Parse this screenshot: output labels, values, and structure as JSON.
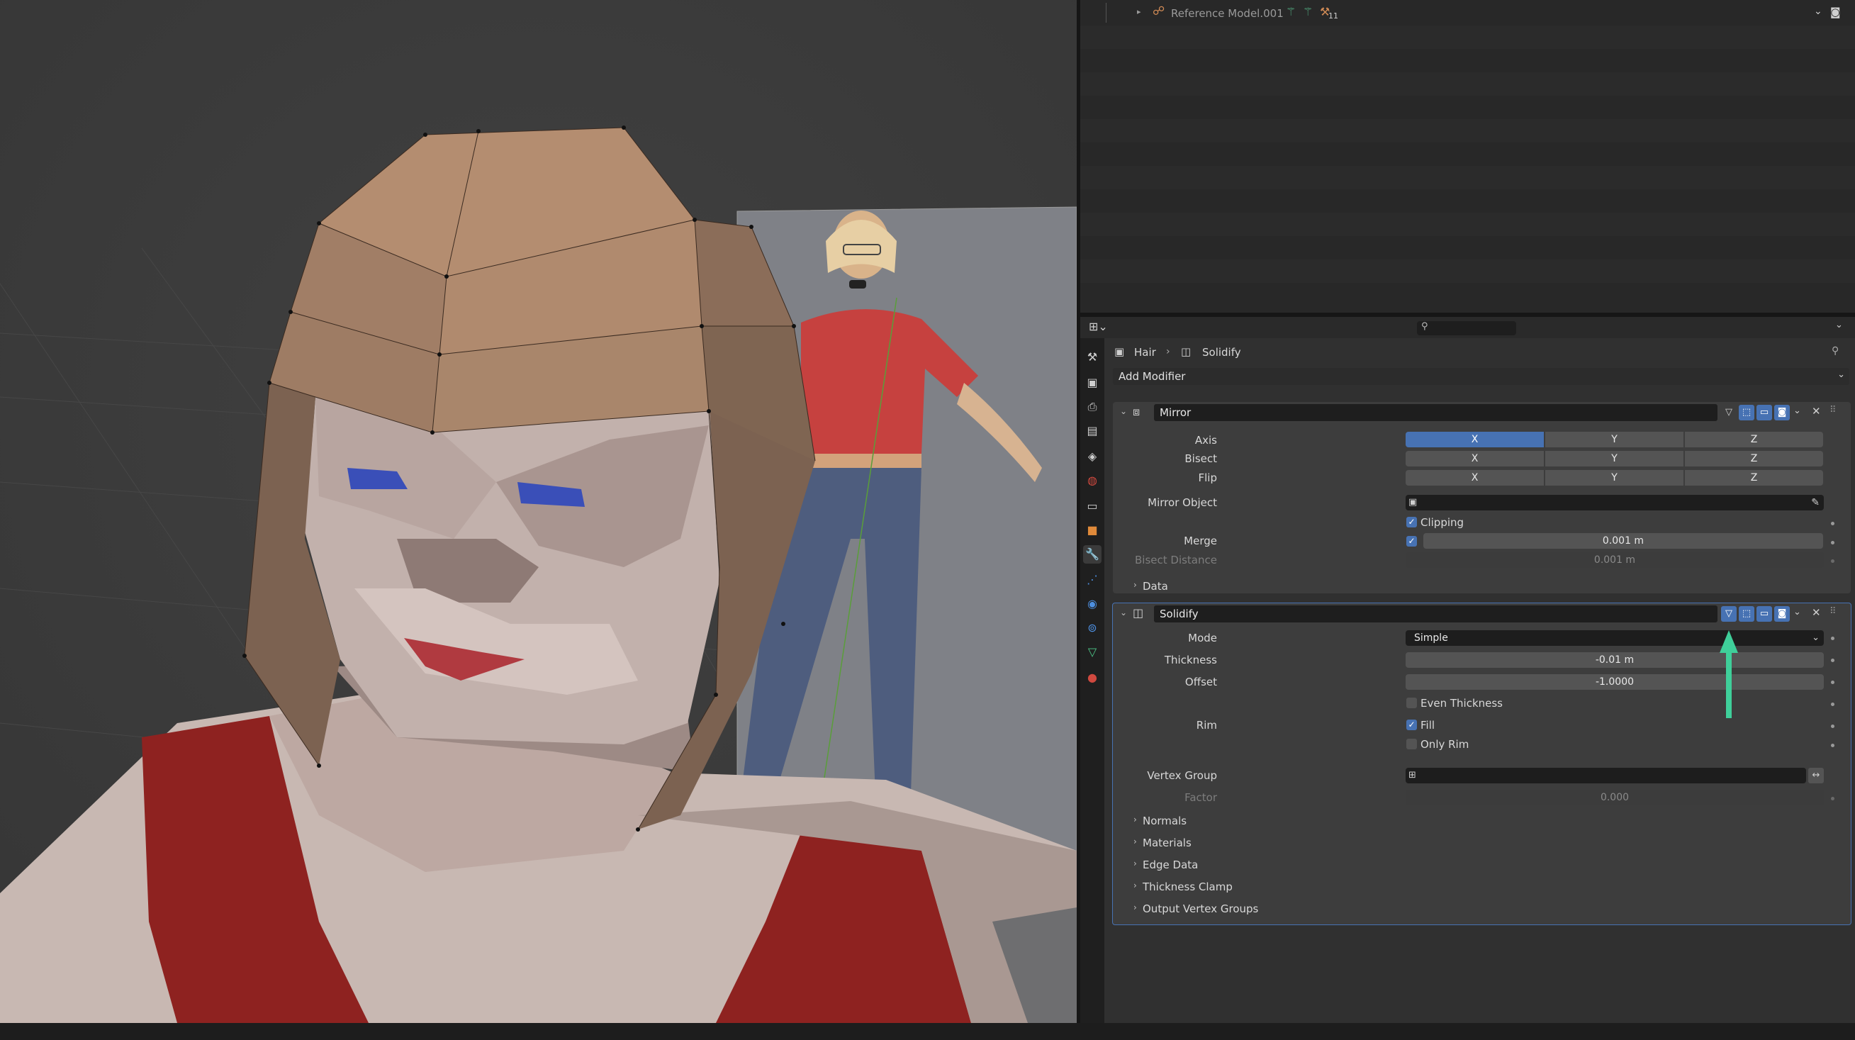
{
  "outliner": {
    "item_label": "Reference Model.001",
    "item_badge": "11"
  },
  "header": {
    "breadcrumb_object": "Hair",
    "breadcrumb_modifier": "Solidify"
  },
  "add_modifier_label": "Add Modifier",
  "mirror": {
    "name": "Mirror",
    "axis_label": "Axis",
    "bisect_label": "Bisect",
    "flip_label": "Flip",
    "x": "X",
    "y": "Y",
    "z": "Z",
    "mirror_object_label": "Mirror Object",
    "clipping_label": "Clipping",
    "merge_label": "Merge",
    "merge_value": "0.001 m",
    "bisect_distance_label": "Bisect Distance",
    "bisect_distance_value": "0.001 m",
    "data_label": "Data"
  },
  "solidify": {
    "name": "Solidify",
    "mode_label": "Mode",
    "mode_value": "Simple",
    "thickness_label": "Thickness",
    "thickness_value": "-0.01 m",
    "offset_label": "Offset",
    "offset_value": "-1.0000",
    "even_thickness_label": "Even Thickness",
    "rim_label": "Rim",
    "fill_label": "Fill",
    "only_rim_label": "Only Rim",
    "vertex_group_label": "Vertex Group",
    "factor_label": "Factor",
    "factor_value": "0.000",
    "subpanels": [
      "Normals",
      "Materials",
      "Edge Data",
      "Thickness Clamp",
      "Output Vertex Groups"
    ]
  },
  "colors": {
    "accent": "#4772b3",
    "annotation_arrow": "#3fcf9a",
    "hair": "#a8846a",
    "shirt": "#8e2220"
  }
}
